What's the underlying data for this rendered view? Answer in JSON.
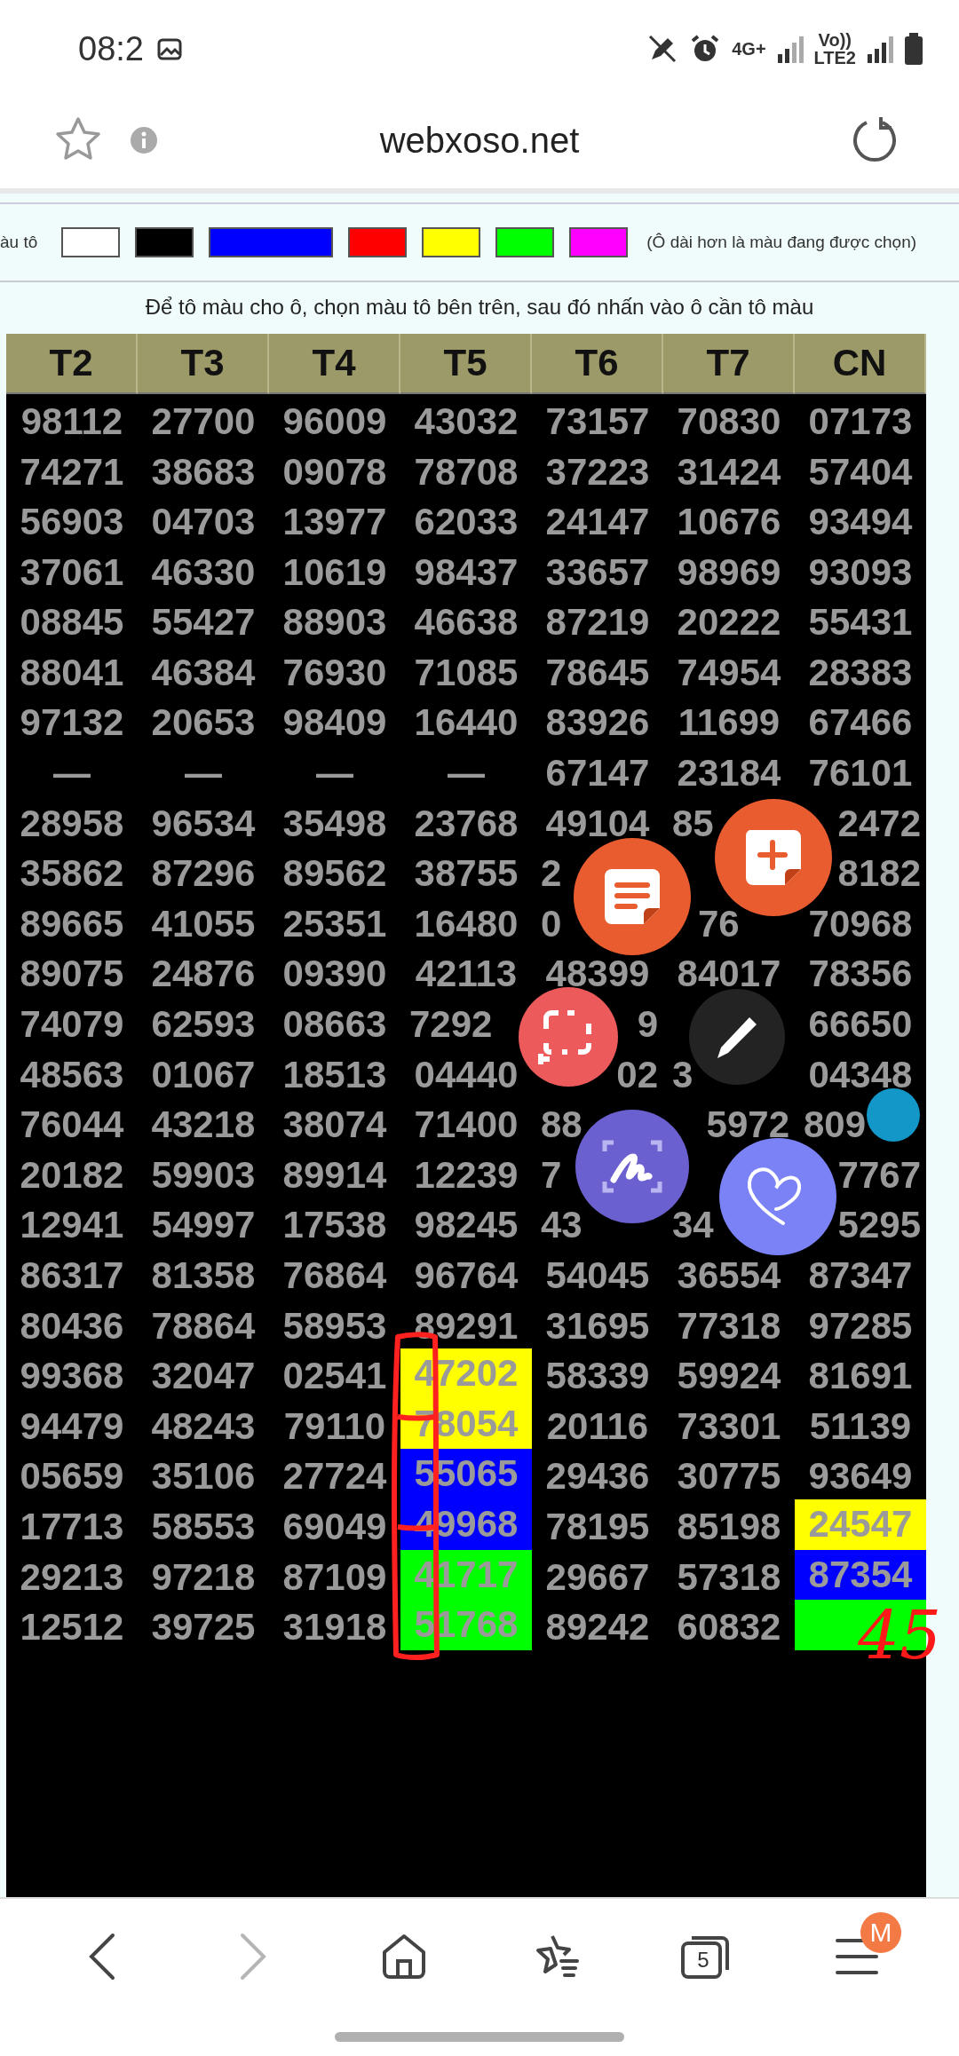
{
  "status_bar": {
    "time": "08:2",
    "network": "4G+",
    "volte": "Vo))",
    "sim_label": "LTE2"
  },
  "browser": {
    "title": "webxoso.net"
  },
  "palette": {
    "label": "àu tô",
    "note": "(Ô dài hơn là màu đang được chọn)",
    "swatches": [
      {
        "color": "#ffffff",
        "selected": false
      },
      {
        "color": "#000000",
        "selected": false
      },
      {
        "color": "#0000ff",
        "selected": true
      },
      {
        "color": "#ff0000",
        "selected": false
      },
      {
        "color": "#ffff00",
        "selected": false
      },
      {
        "color": "#00ff00",
        "selected": false
      },
      {
        "color": "#ff00ff",
        "selected": false
      }
    ]
  },
  "instruction": "Để tô màu cho ô, chọn màu tô bên trên, sau đó nhấn vào ô cần tô màu",
  "table": {
    "columns": [
      "T2",
      "T3",
      "T4",
      "T5",
      "T6",
      "T7",
      "CN"
    ],
    "rows": [
      [
        "98112",
        "27700",
        "96009",
        "43032",
        "73157",
        "70830",
        "07173"
      ],
      [
        "74271",
        "38683",
        "09078",
        "78708",
        "37223",
        "31424",
        "57404"
      ],
      [
        "56903",
        "04703",
        "13977",
        "62033",
        "24147",
        "10676",
        "93494"
      ],
      [
        "37061",
        "46330",
        "10619",
        "98437",
        "33657",
        "98969",
        "93093"
      ],
      [
        "08845",
        "55427",
        "88903",
        "46638",
        "87219",
        "20222",
        "55431"
      ],
      [
        "88041",
        "46384",
        "76930",
        "71085",
        "78645",
        "74954",
        "28383"
      ],
      [
        "97132",
        "20653",
        "98409",
        "16440",
        "83926",
        "11699",
        "67466"
      ],
      [
        "—",
        "—",
        "—",
        "—",
        "67147",
        "23184",
        "76101"
      ],
      [
        "28958",
        "96534",
        "35498",
        "23768",
        "49104",
        {
          "text": "85",
          "kind": "cut-end"
        },
        {
          "text": "2472",
          "kind": "cut-start"
        }
      ],
      [
        "35862",
        "87296",
        "89562",
        "38755",
        {
          "text": "2",
          "kind": "cut-end"
        },
        null,
        {
          "text": "8182",
          "kind": "cut-start"
        }
      ],
      [
        "89665",
        "41055",
        "25351",
        "16480",
        {
          "text": "0",
          "kind": "cut-end"
        },
        {
          "text": "76",
          "kind": "cut-both"
        },
        "70968"
      ],
      [
        "89075",
        "24876",
        "09390",
        "42113",
        "48399",
        "84017",
        "78356"
      ],
      [
        "74079",
        "62593",
        "08663",
        {
          "text": "7292",
          "kind": "cut-end"
        },
        {
          "text": "9",
          "kind": "cut-start"
        },
        null,
        "66650"
      ],
      [
        "48563",
        "01067",
        "18513",
        "04440",
        {
          "text": "02",
          "kind": "cut-start"
        },
        {
          "text": "3",
          "kind": "cut-end"
        },
        "04348"
      ],
      [
        "76044",
        "43218",
        "38074",
        "71400",
        {
          "text": "88",
          "kind": "cut-end"
        },
        {
          "text": "5972",
          "kind": "cut-start"
        },
        {
          "text": "809",
          "kind": "cut-end"
        }
      ],
      [
        "20182",
        "59903",
        "89914",
        "12239",
        {
          "text": "7",
          "kind": "cut-end"
        },
        null,
        {
          "text": "7767",
          "kind": "cut-start"
        }
      ],
      [
        "12941",
        "54997",
        "17538",
        "98245",
        {
          "text": "43",
          "kind": "cut-end"
        },
        {
          "text": "34",
          "kind": "cut-end"
        },
        {
          "text": "5295",
          "kind": "cut-start"
        }
      ],
      [
        "86317",
        "81358",
        "76864",
        "96764",
        "54045",
        "36554",
        "87347"
      ],
      [
        "80436",
        "78864",
        "58953",
        "89291",
        "31695",
        "77318",
        "97285"
      ],
      [
        "99368",
        "32047",
        "02541",
        {
          "text": "47202",
          "color": "#ffff00"
        },
        "58339",
        "59924",
        "81691"
      ],
      [
        "94479",
        "48243",
        "79110",
        {
          "text": "78054",
          "color": "#ffff00"
        },
        "20116",
        "73301",
        "51139"
      ],
      [
        "05659",
        "35106",
        "27724",
        {
          "text": "55065",
          "color": "#0000ff"
        },
        "29436",
        "30775",
        "93649"
      ],
      [
        "17713",
        "58553",
        "69049",
        {
          "text": "49968",
          "color": "#0000ff"
        },
        "78195",
        "85198",
        {
          "text": "24547",
          "color": "#ffff00"
        }
      ],
      [
        "29213",
        "97218",
        "87109",
        {
          "text": "41717",
          "color": "#00ff00"
        },
        "29667",
        "57318",
        {
          "text": "87354",
          "color": "#0000ff"
        }
      ],
      [
        "12512",
        "39725",
        "31918",
        {
          "text": "51768",
          "color": "#00ff00"
        },
        "89242",
        "60832",
        {
          "color": "#00ff00"
        }
      ]
    ]
  },
  "annotation": {
    "text": "45"
  },
  "bottom_nav": {
    "forward_disabled": true,
    "tab_count": "5",
    "profile_badge": "M"
  }
}
